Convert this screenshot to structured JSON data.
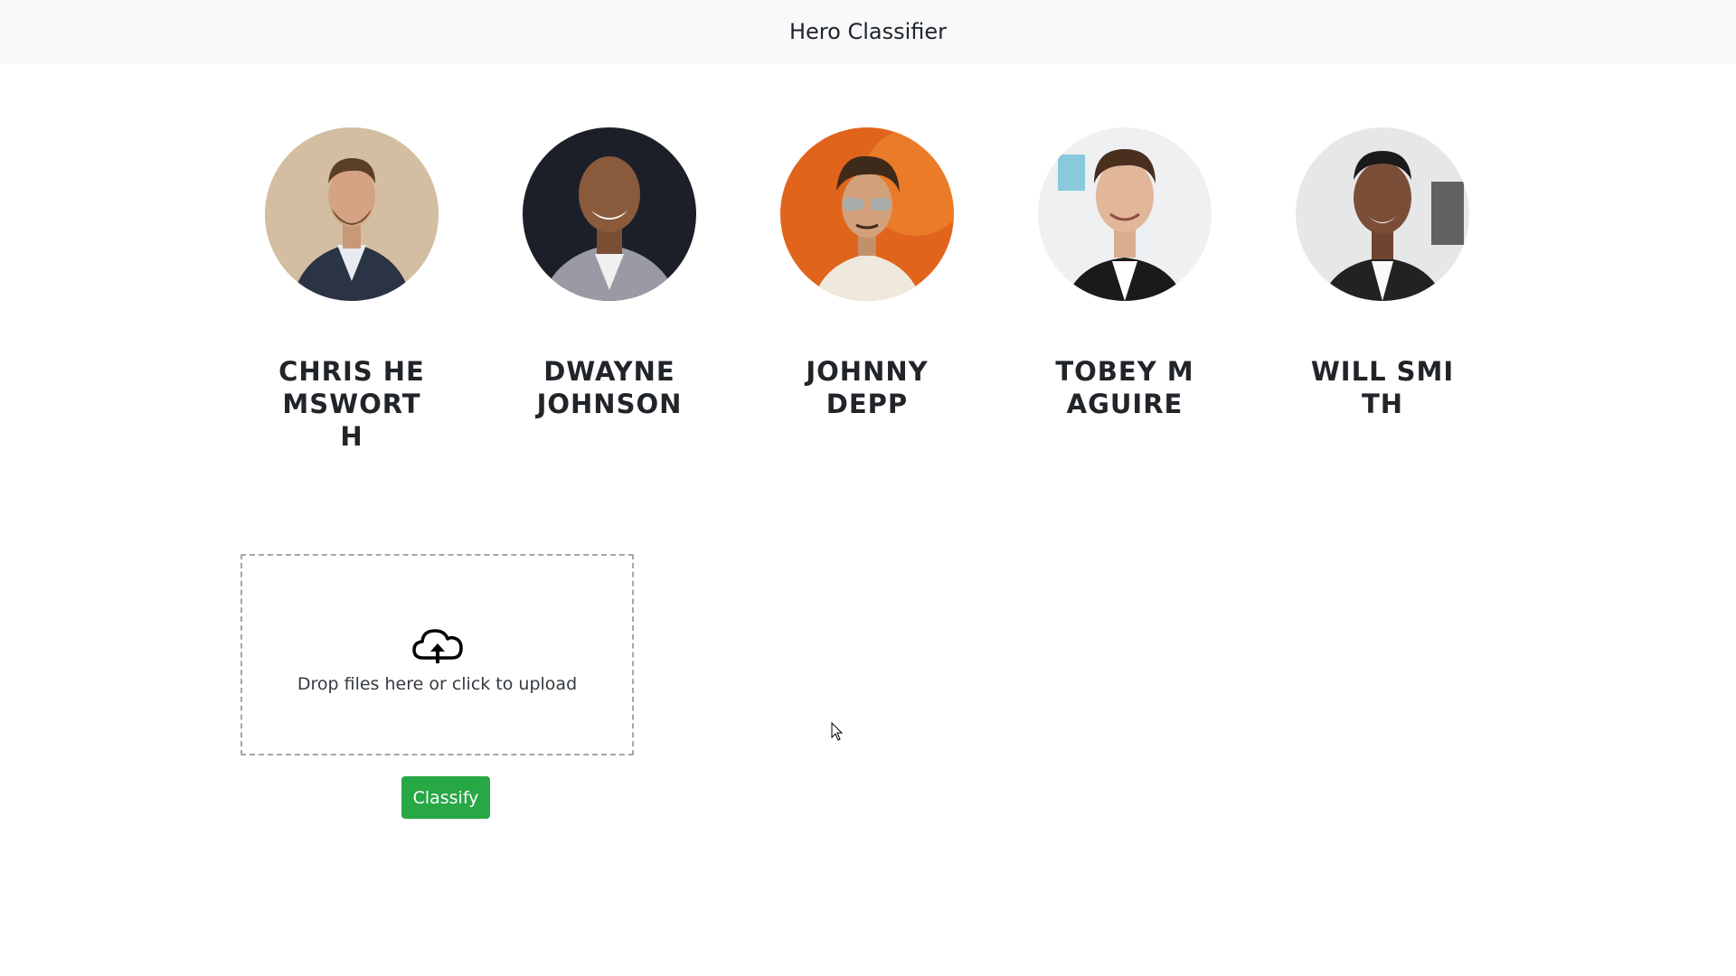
{
  "navbar": {
    "brand": "Hero Classifier"
  },
  "heroes": [
    {
      "name": "Chris Hemsworth",
      "photo_icon": "person-photo-icon"
    },
    {
      "name": "Dwayne Johnson",
      "photo_icon": "person-photo-icon"
    },
    {
      "name": "Johnny Depp",
      "photo_icon": "person-photo-icon"
    },
    {
      "name": "Tobey Maguire",
      "photo_icon": "person-photo-icon"
    },
    {
      "name": "Will Smith",
      "photo_icon": "person-photo-icon"
    }
  ],
  "upload": {
    "text": "Drop files here or click to upload",
    "icon": "cloud-upload-icon"
  },
  "classify_button": {
    "label": "Classify",
    "color": "#28a745"
  },
  "colors": {
    "navbar_bg": "#f8f9fa",
    "accent": "#28a745"
  }
}
